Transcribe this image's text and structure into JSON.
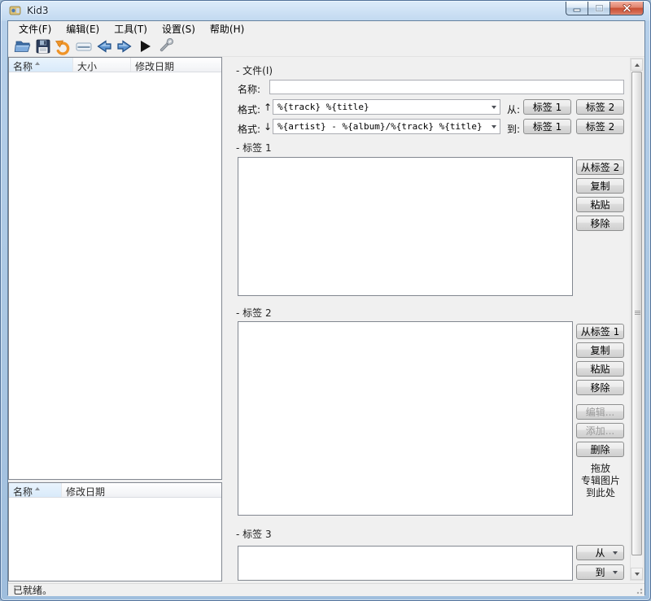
{
  "window": {
    "title": "Kid3"
  },
  "ui": {
    "collapse_glyph": "-",
    "up_arrow": "↑",
    "down_arrow": "↓"
  },
  "menu": {
    "items": [
      "文件(F)",
      "编辑(E)",
      "工具(T)",
      "设置(S)",
      "帮助(H)"
    ]
  },
  "toolbar": {
    "icons": [
      "open",
      "save",
      "revert",
      "rename",
      "previous-file",
      "next-file",
      "play",
      "configure"
    ]
  },
  "file_panel": {
    "columns": [
      "名称",
      "大小",
      "修改日期"
    ]
  },
  "folder_panel": {
    "columns": [
      "名称",
      "修改日期"
    ]
  },
  "file_section": {
    "title": "文件(I)",
    "name_label": "名称:",
    "format_label": "格式:",
    "from_label": "从:",
    "to_label": "到:",
    "name_value": "",
    "format_from_value": "%{track} %{title}",
    "format_to_value": "%{artist} - %{album}/%{track} %{title}",
    "tag1_button": "标签 1",
    "tag2_button": "标签 2"
  },
  "tag1_section": {
    "title": "标签 1",
    "from_tag2_button": "从标签 2",
    "copy_button": "复制",
    "paste_button": "粘贴",
    "remove_button": "移除"
  },
  "tag2_section": {
    "title": "标签 2",
    "from_tag1_button": "从标签 1",
    "copy_button": "复制",
    "paste_button": "粘贴",
    "remove_button": "移除",
    "edit_button": "编辑...",
    "add_button": "添加...",
    "delete_button": "删除",
    "drop_hint": [
      "拖放",
      "专辑图片",
      "到此处"
    ]
  },
  "tag3_section": {
    "title": "标签 3",
    "from_button": "从",
    "to_button": "到"
  },
  "statusbar": {
    "text": "已就绪。"
  }
}
